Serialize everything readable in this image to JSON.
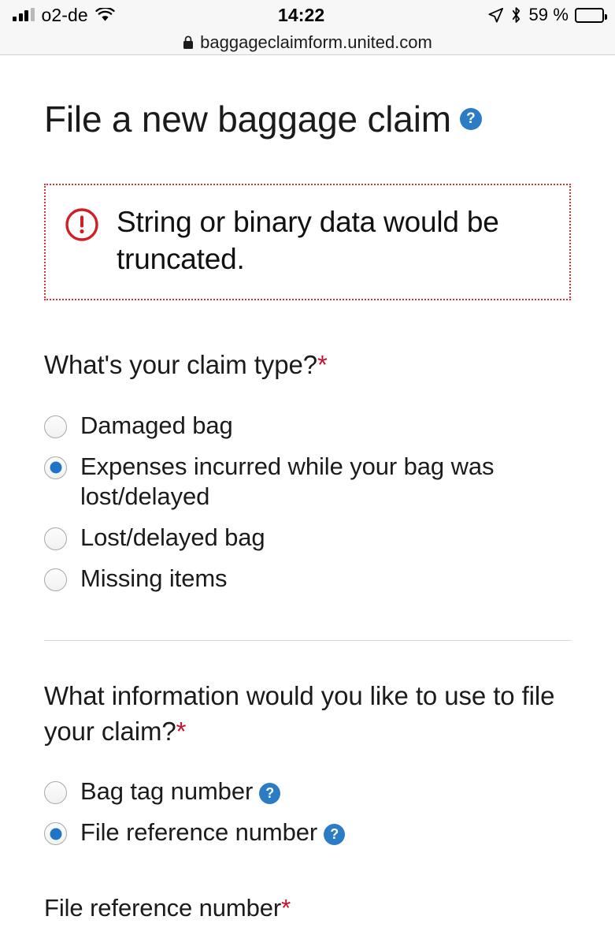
{
  "status_bar": {
    "carrier": "o2-de",
    "time": "14:22",
    "battery_percent": "59 %",
    "battery_level": 59,
    "signal_icon": "signal-bars-icon",
    "wifi_icon": "wifi-icon",
    "location_icon": "location-arrow-icon",
    "bluetooth_icon": "bluetooth-icon",
    "battery_icon": "battery-icon"
  },
  "browser": {
    "url": "baggageclaimform.united.com",
    "lock_icon": "lock-icon"
  },
  "page": {
    "title": "File a new baggage claim",
    "title_help_icon": "help-icon",
    "alert": {
      "icon": "error-exclamation-icon",
      "message": "String or binary data would be truncated.",
      "border_color": "#e03030"
    },
    "question_1": {
      "label": "What's your claim type?",
      "required_marker": "*",
      "options": [
        {
          "label": "Damaged bag",
          "selected": false
        },
        {
          "label": "Expenses incurred while your bag was lost/delayed",
          "selected": true
        },
        {
          "label": "Lost/delayed bag",
          "selected": false
        },
        {
          "label": "Missing items",
          "selected": false
        }
      ]
    },
    "question_2": {
      "label": "What information would you like to use to file your claim?",
      "required_marker": "*",
      "options": [
        {
          "label": "Bag tag number",
          "selected": false,
          "help_icon": "help-icon"
        },
        {
          "label": "File reference number",
          "selected": true,
          "help_icon": "help-icon"
        }
      ]
    },
    "field": {
      "label": "File reference number",
      "required_marker": "*"
    },
    "colors": {
      "accent_blue": "#2b7cc4",
      "required_red": "#c8102e",
      "error_red": "#e03030",
      "radio_selected": "#1f74c6"
    }
  }
}
